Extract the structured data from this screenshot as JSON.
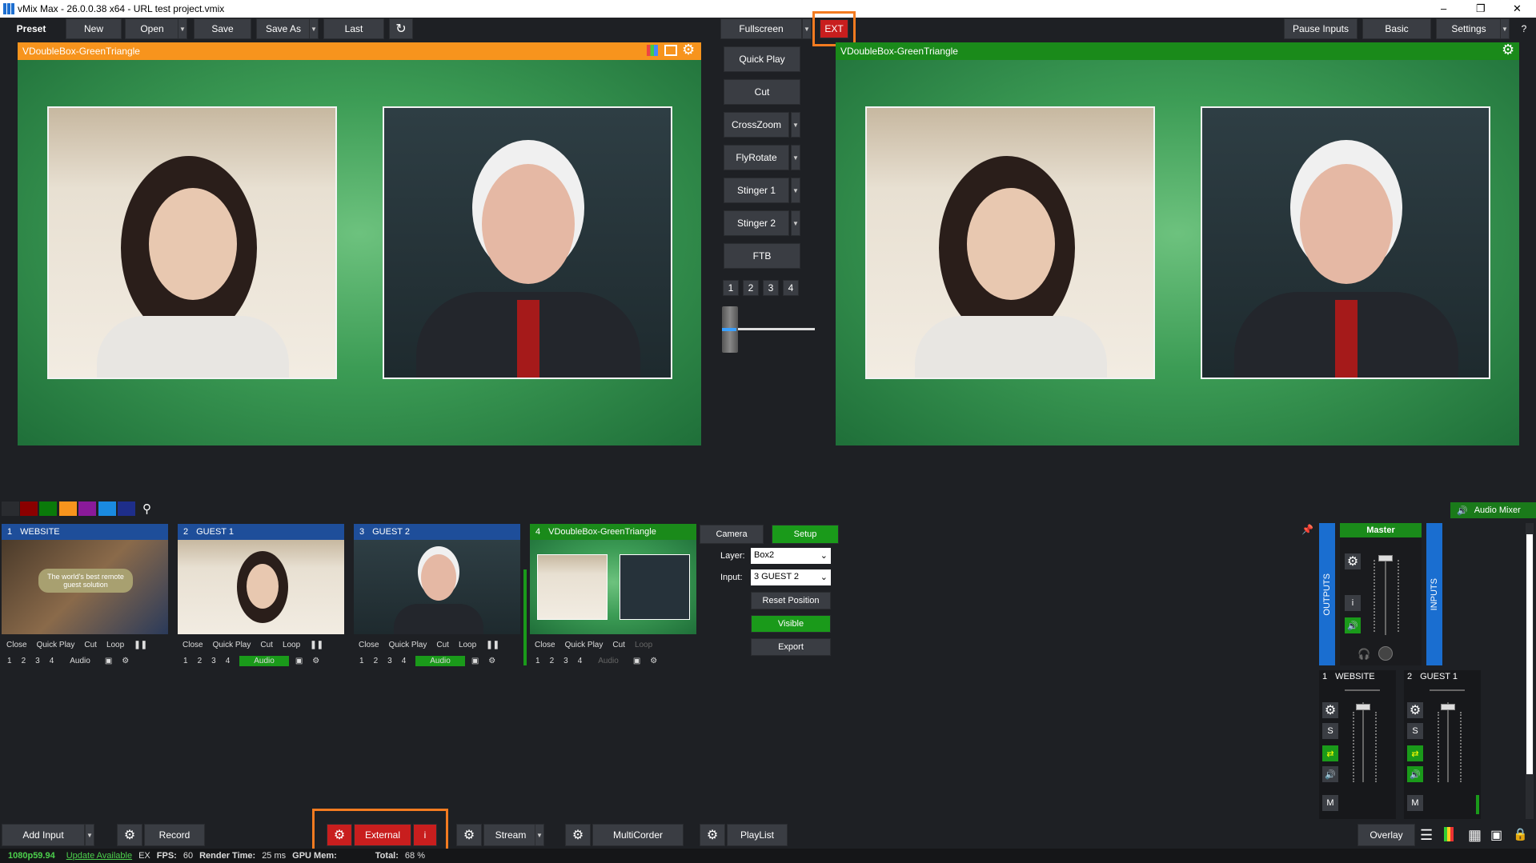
{
  "window": {
    "title": "vMix Max - 26.0.0.38 x64 - URL test project.vmix"
  },
  "toolbar": {
    "preset": "Preset",
    "new": "New",
    "open": "Open",
    "save": "Save",
    "save_as": "Save As",
    "last": "Last",
    "fullscreen": "Fullscreen",
    "ext": "EXT",
    "pause_inputs": "Pause Inputs",
    "basic": "Basic",
    "settings": "Settings",
    "help": "?"
  },
  "preview": {
    "title": "VDoubleBox-GreenTriangle"
  },
  "output": {
    "title": "VDoubleBox-GreenTriangle"
  },
  "transitions": {
    "quick_play": "Quick Play",
    "cut": "Cut",
    "crosszoom": "CrossZoom",
    "flyrotate": "FlyRotate",
    "stinger1": "Stinger 1",
    "stinger2": "Stinger 2",
    "ftb": "FTB",
    "nums": [
      "1",
      "2",
      "3",
      "4"
    ]
  },
  "inputs": [
    {
      "num": "1",
      "name": "WEBSITE",
      "overlay_text": "The world's best remote guest solution"
    },
    {
      "num": "2",
      "name": "GUEST 1"
    },
    {
      "num": "3",
      "name": "GUEST 2"
    },
    {
      "num": "4",
      "name": "VDoubleBox-GreenTriangle"
    }
  ],
  "input_buttons": {
    "close": "Close",
    "quick_play": "Quick Play",
    "cut": "Cut",
    "loop": "Loop",
    "audio": "Audio",
    "nums": [
      "1",
      "2",
      "3",
      "4"
    ]
  },
  "layer_panel": {
    "camera": "Camera",
    "setup": "Setup",
    "layer_label": "Layer:",
    "layer_value": "Box2",
    "input_label": "Input:",
    "input_value": "3 GUEST 2",
    "reset": "Reset Position",
    "visible": "Visible",
    "export": "Export"
  },
  "audio": {
    "title": "Audio Mixer",
    "master": "Master",
    "outputs": "OUTPUTS",
    "inputs": "INPUTS",
    "ch1_num": "1",
    "ch1": "WEBSITE",
    "ch2_num": "2",
    "ch2": "GUEST 1",
    "info": "i",
    "solo": "S",
    "mute": "M"
  },
  "bottom": {
    "add_input": "Add Input",
    "record": "Record",
    "external": "External",
    "ext_info": "i",
    "stream": "Stream",
    "multicorder": "MultiCorder",
    "playlist": "PlayList",
    "overlay": "Overlay"
  },
  "status": {
    "format": "1080p59.94",
    "update": "Update Available",
    "ex": "EX",
    "fps_label": "FPS:",
    "fps": "60",
    "render_label": "Render Time:",
    "render": "25 ms",
    "gpu_label": "GPU Mem:",
    "total_label": "Total:",
    "total": "68 %"
  },
  "colors": {
    "accent_orange": "#f47b20",
    "preview_bar": "#f7941d",
    "output_bar": "#1a8a1a",
    "input_head": "#1e4e9a",
    "external_red": "#c81e1e"
  },
  "swatches": [
    "#8b0000",
    "#0a7a0a",
    "#f7941d",
    "#8a1a9a",
    "#1a8ae0",
    "#1e2e8a"
  ]
}
